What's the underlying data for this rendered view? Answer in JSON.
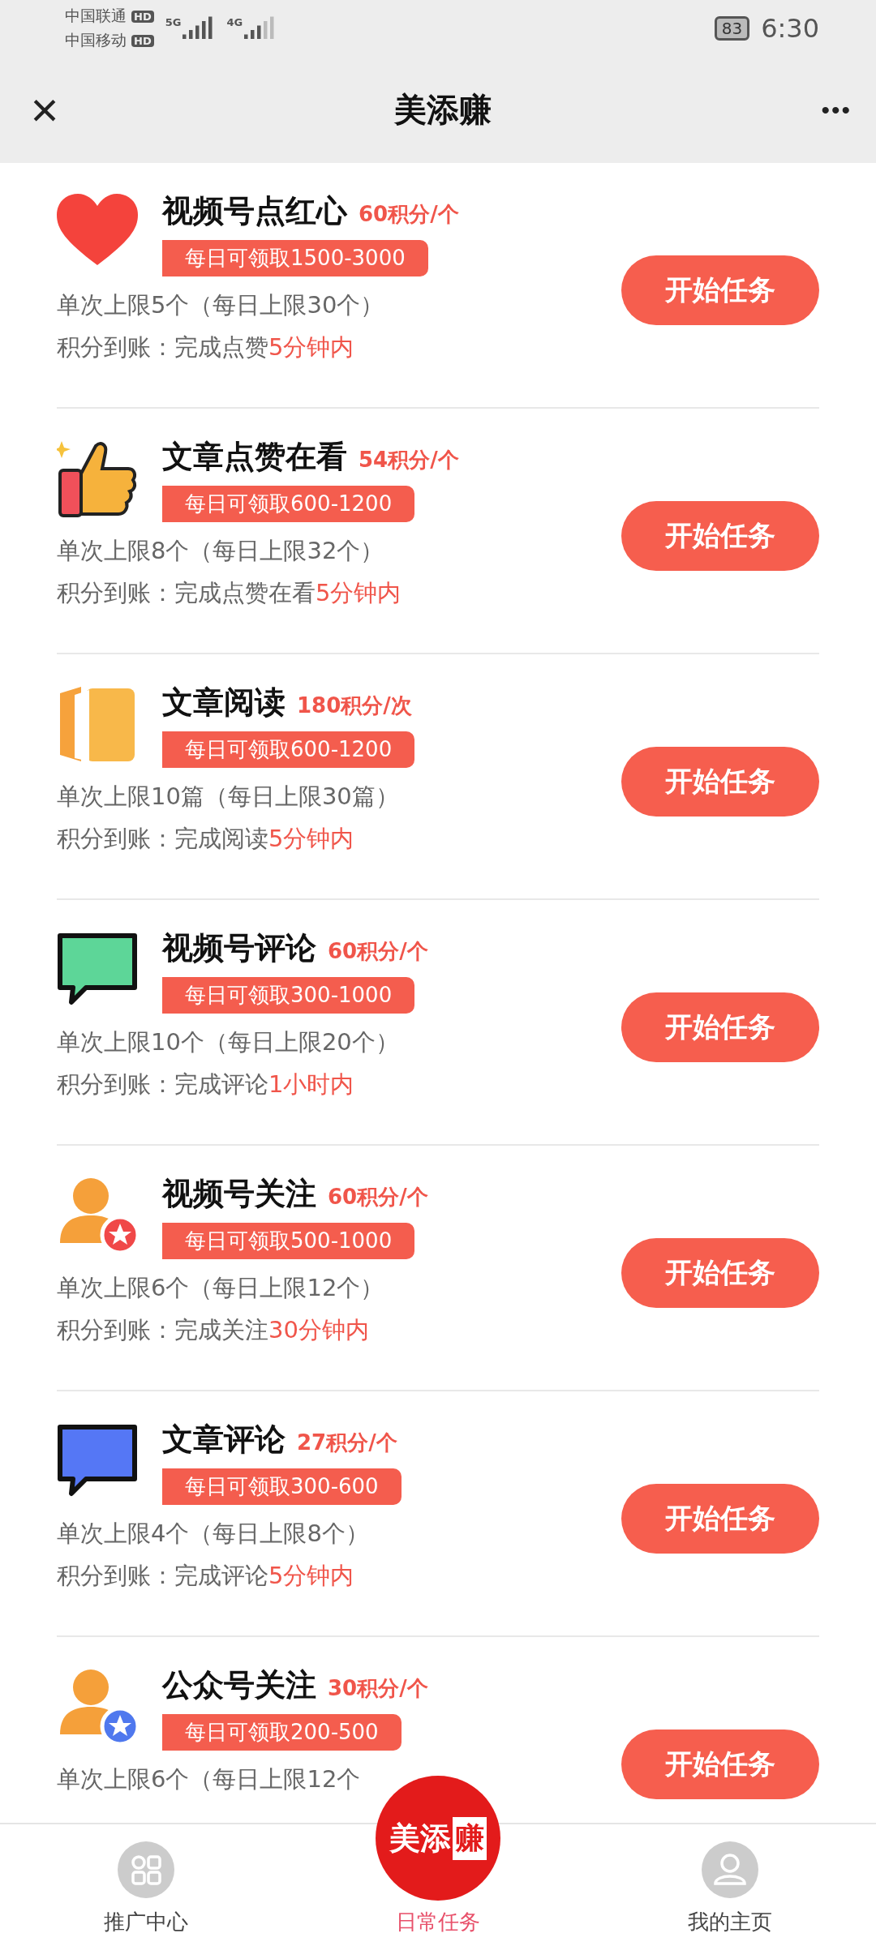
{
  "status_bar": {
    "carriers": [
      {
        "name": "中国联通",
        "tag": "HD",
        "network": "5G"
      },
      {
        "name": "中国移动",
        "tag": "HD",
        "network": "4G"
      }
    ],
    "battery": "83",
    "time": "6:30"
  },
  "nav_bar": {
    "close": "×",
    "title": "美添赚",
    "more": "•••"
  },
  "tasks": [
    {
      "kind": "heart",
      "title": "视频号点红心",
      "points": "60积分/个",
      "daily": "每日可领取1500-3000",
      "limit": "单次上限5个（每日上限30个）",
      "reward": "积分到账：完成点赞",
      "reward_time": "5分钟内",
      "button": "开始任务"
    },
    {
      "kind": "thumb",
      "title": "文章点赞在看",
      "points": "54积分/个",
      "daily": "每日可领取600-1200",
      "limit": "单次上限8个（每日上限32个）",
      "reward": "积分到账：完成点赞在看",
      "reward_time": "5分钟内",
      "button": "开始任务"
    },
    {
      "kind": "book",
      "title": "文章阅读",
      "points": "180积分/次",
      "daily": "每日可领取600-1200",
      "limit": "单次上限10篇（每日上限30篇）",
      "reward": "积分到账：完成阅读",
      "reward_time": "5分钟内",
      "button": "开始任务"
    },
    {
      "kind": "bubble",
      "color": "#5dd698",
      "title": "视频号评论",
      "points": "60积分/个",
      "daily": "每日可领取300-1000",
      "limit": "单次上限10个（每日上限20个）",
      "reward": "积分到账：完成评论",
      "reward_time": "1小时内",
      "button": "开始任务"
    },
    {
      "kind": "person",
      "color": "#f04848",
      "title": "视频号关注",
      "points": "60积分/个",
      "daily": "每日可领取500-1000",
      "limit": "单次上限6个（每日上限12个）",
      "reward": "积分到账：完成关注",
      "reward_time": "30分钟内",
      "button": "开始任务"
    },
    {
      "kind": "bubble",
      "color": "#5577f5",
      "title": "文章评论",
      "points": "27积分/个",
      "daily": "每日可领取300-600",
      "limit": "单次上限4个（每日上限8个）",
      "reward": "积分到账：完成评论",
      "reward_time": "5分钟内",
      "button": "开始任务"
    },
    {
      "kind": "person",
      "color": "#4f78ee",
      "title": "公众号关注",
      "points": "30积分/个",
      "daily": "每日可领取200-500",
      "limit": "单次上限6个（每日上限12个",
      "button": "开始任务"
    }
  ],
  "tab_bar": {
    "logo": {
      "left": "美添",
      "right": "赚"
    },
    "tabs": [
      {
        "label": "推广中心",
        "kind": "grid",
        "selected": false
      },
      {
        "label": "日常任务",
        "kind": "logo",
        "selected": true
      },
      {
        "label": "我的主页",
        "kind": "user",
        "selected": false
      }
    ]
  }
}
